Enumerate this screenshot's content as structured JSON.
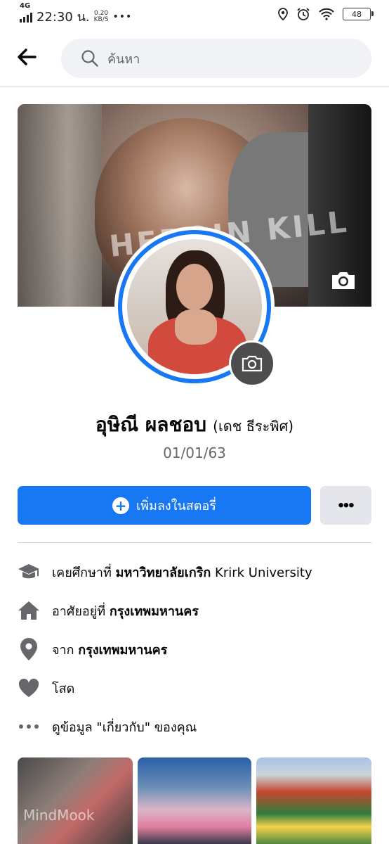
{
  "status_bar": {
    "network": "4G",
    "time": "22:30 น.",
    "speed_value": "0.20",
    "speed_unit": "KB/S",
    "battery": "48"
  },
  "header": {
    "search_placeholder": "ค้นหา"
  },
  "cover": {
    "text": "HEROIN KILL"
  },
  "profile": {
    "name": "อุษิณี ผลชอบ",
    "alternate_name": "(เดช ธีระพิศ)",
    "bio": "01/01/63"
  },
  "actions": {
    "add_story_label": "เพิ่มลงในสตอรี่",
    "more_label": "•••"
  },
  "details": {
    "education_prefix": "เคยศึกษาที่",
    "education_school": "มหาวิทยาลัยเกริก",
    "education_suffix": "Krirk University",
    "lives_prefix": "อาศัยอยู่ที่",
    "lives_city": "กรุงเทพมหานคร",
    "from_prefix": "จาก",
    "from_city": "กรุงเทพมหานคร",
    "relationship": "โสด",
    "about_link": "ดูข้อมูล \"เกี่ยวกับ\" ของคุณ"
  },
  "photos": {
    "watermark": "MindMook"
  },
  "colors": {
    "accent": "#1877f2",
    "secondary_button": "#e4e6eb",
    "icon_gray": "#65676b"
  }
}
